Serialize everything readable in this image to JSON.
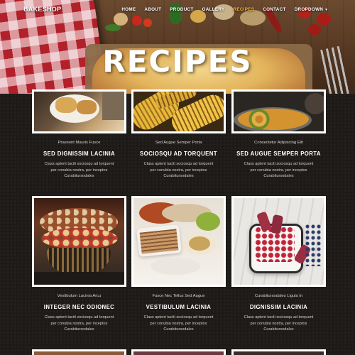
{
  "header": {
    "brand": "BAKESHOP",
    "nav": [
      {
        "label": "HOME",
        "active": false
      },
      {
        "label": "ABOUT",
        "active": false
      },
      {
        "label": "PRODUCT",
        "active": false
      },
      {
        "label": "GALLERY",
        "active": false
      },
      {
        "label": "RECIPES",
        "active": true
      },
      {
        "label": "CONTACT",
        "active": false
      },
      {
        "label": "DROPDOWN",
        "active": false,
        "caret": "▾"
      }
    ],
    "hero_title": "RECIPES",
    "active_color": "#f3b23a"
  },
  "recipes": [
    {
      "category": "Praesent Mauris Fusce",
      "title": "SED DIGNISSIM LACINIA",
      "desc": [
        "Class aptent taciti sociosqu ad torquent",
        "per conubia nostra, per inceptos",
        "Curabitursodales"
      ]
    },
    {
      "category": "Sed Augue Semper Porta",
      "title": "SOCIOSQU AD TORQUENT",
      "desc": [
        "Class aptent taciti sociosqu ad torquent",
        "per conubia nostra, per inceptos",
        "Curabitursodales"
      ]
    },
    {
      "category": "Consectetur Adipiscing Elit",
      "title": "SED AUGUE SEMPER PORTA",
      "desc": [
        "Class aptent taciti sociosqu ad torquent",
        "per conubia nostra, per inceptos",
        "Curabitursodales"
      ]
    },
    {
      "category": "Vestibulum Lacinia Arcu",
      "title": "INTEGER NEC ODIONEC",
      "desc": [
        "Class aptent taciti sociosqu ad torquent",
        "per conubia nostra, per inceptos",
        "Curabitursodales"
      ]
    },
    {
      "category": "Fusce Nec Tellus Sed Augue",
      "title": "VESTIBULUM LACINIA",
      "desc": [
        "Class aptent taciti sociosqu ad torquent",
        "per conubia nostra, per inceptos",
        "Curabitursodales"
      ]
    },
    {
      "category": "Curabitursodales Ligula In",
      "title": "DIGNISSIM LACINIA",
      "desc": [
        "Class aptent taciti sociosqu ad torquent",
        "per conubia nostra, per inceptos",
        "Curabitursodales"
      ]
    }
  ]
}
